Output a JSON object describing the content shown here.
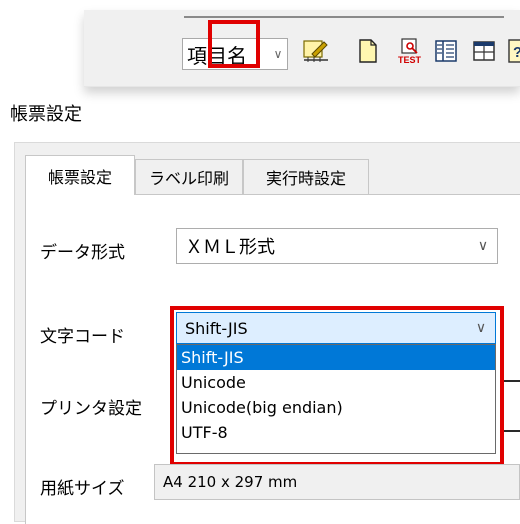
{
  "toolbar": {
    "combo_value": "項目名",
    "buttons": [
      "edit-form-icon",
      "new-page-icon",
      "test-print-icon",
      "columns-icon",
      "layout-icon",
      "help-icon"
    ],
    "test_label": "TEST",
    "help_glyph": "?"
  },
  "page_title": "帳票設定",
  "tabs": [
    {
      "label": "帳票設定",
      "active": true
    },
    {
      "label": "ラベル印刷",
      "active": false
    },
    {
      "label": "実行時設定",
      "active": false
    }
  ],
  "form": {
    "data_format_label": "データ形式",
    "data_format_value": "ＸＭＬ形式",
    "char_code_label": "文字コード",
    "char_code_value": "Shift-JIS",
    "printer_label": "プリンタ設定",
    "paper_size_label": "用紙サイズ",
    "paper_size_value": "A4 210 x 297 mm"
  },
  "dropdown_options": [
    "Shift-JIS",
    "Unicode",
    "Unicode(big endian)",
    "UTF-8"
  ],
  "colors": {
    "highlight": "#e00000",
    "selection": "#0078d7"
  }
}
